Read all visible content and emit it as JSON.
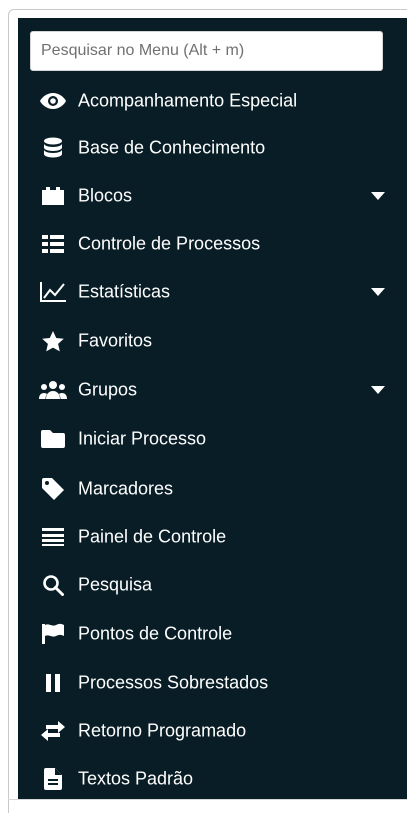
{
  "search": {
    "placeholder": "Pesquisar no Menu (Alt + m)"
  },
  "menu": {
    "items": [
      {
        "label": "Acompanhamento Especial",
        "icon": "eye-icon",
        "has_submenu": false
      },
      {
        "label": "Base de Conhecimento",
        "icon": "database-icon",
        "has_submenu": false
      },
      {
        "label": "Blocos",
        "icon": "blocks-icon",
        "has_submenu": true
      },
      {
        "label": "Controle de Processos",
        "icon": "list-grid-icon",
        "has_submenu": false
      },
      {
        "label": "Estatísticas",
        "icon": "line-chart-icon",
        "has_submenu": true
      },
      {
        "label": "Favoritos",
        "icon": "star-icon",
        "has_submenu": false
      },
      {
        "label": "Grupos",
        "icon": "users-icon",
        "has_submenu": true
      },
      {
        "label": "Iniciar Processo",
        "icon": "folder-icon",
        "has_submenu": false
      },
      {
        "label": "Marcadores",
        "icon": "tag-icon",
        "has_submenu": false
      },
      {
        "label": "Painel de Controle",
        "icon": "lines-icon",
        "has_submenu": false
      },
      {
        "label": "Pesquisa",
        "icon": "search-icon",
        "has_submenu": false
      },
      {
        "label": "Pontos de Controle",
        "icon": "flag-icon",
        "has_submenu": false
      },
      {
        "label": "Processos Sobrestados",
        "icon": "pause-icon",
        "has_submenu": false
      },
      {
        "label": "Retorno Programado",
        "icon": "exchange-arrows-icon",
        "has_submenu": false
      },
      {
        "label": "Textos Padrão",
        "icon": "file-text-icon",
        "has_submenu": false
      }
    ]
  },
  "colors": {
    "panel_background": "#091d26",
    "text": "#ffffff",
    "page_background": "#ffffff"
  }
}
